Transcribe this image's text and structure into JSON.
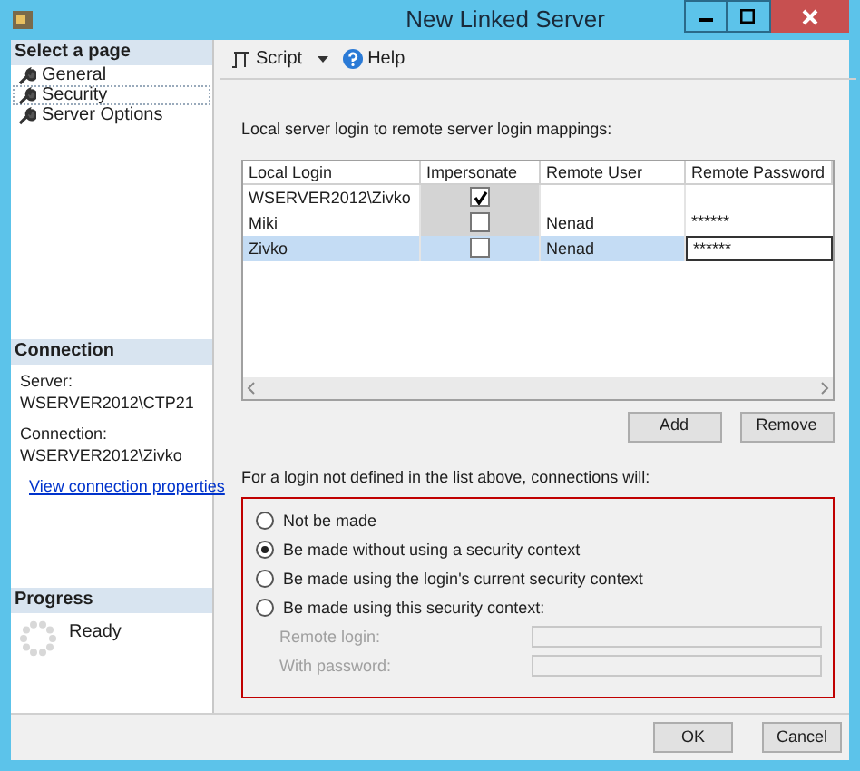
{
  "window": {
    "title": "New Linked Server"
  },
  "sidebar": {
    "heading": "Select a page",
    "items": [
      {
        "label": "General",
        "selected": false
      },
      {
        "label": "Security",
        "selected": true
      },
      {
        "label": "Server Options",
        "selected": false
      }
    ]
  },
  "connection": {
    "heading": "Connection",
    "server_label": "Server:",
    "server": "WSERVER2012\\CTP21",
    "connection_label": "Connection:",
    "connection": "WSERVER2012\\Zivko",
    "link": "View connection properties"
  },
  "progress": {
    "heading": "Progress",
    "status": "Ready"
  },
  "toolbar": {
    "script": "Script",
    "help": "Help"
  },
  "mappings": {
    "caption": "Local server login to remote server login mappings:",
    "columns": [
      "Local Login",
      "Impersonate",
      "Remote User",
      "Remote Password"
    ],
    "rows": [
      {
        "local_login": "WSERVER2012\\Zivko",
        "impersonate": true,
        "remote_user": "",
        "remote_password": "",
        "selected": false
      },
      {
        "local_login": "Miki",
        "impersonate": false,
        "remote_user": "Nenad",
        "remote_password": "******",
        "selected": false
      },
      {
        "local_login": "Zivko",
        "impersonate": false,
        "remote_user": "Nenad",
        "remote_password": "******",
        "selected": true
      }
    ],
    "buttons": [
      "Add",
      "Remove"
    ]
  },
  "fallback": {
    "caption": "For a login not defined in the list above, connections will:",
    "options": [
      {
        "label": "Not be made",
        "selected": false
      },
      {
        "label": "Be made without using a security context",
        "selected": true
      },
      {
        "label": "Be made using the login's current security context",
        "selected": false
      },
      {
        "label": "Be made using this security context:",
        "selected": false
      }
    ],
    "fields": [
      {
        "label": "Remote login:",
        "disabled": true
      },
      {
        "label": "With password:",
        "disabled": true
      }
    ]
  },
  "buttons": [
    "OK",
    "Cancel"
  ]
}
